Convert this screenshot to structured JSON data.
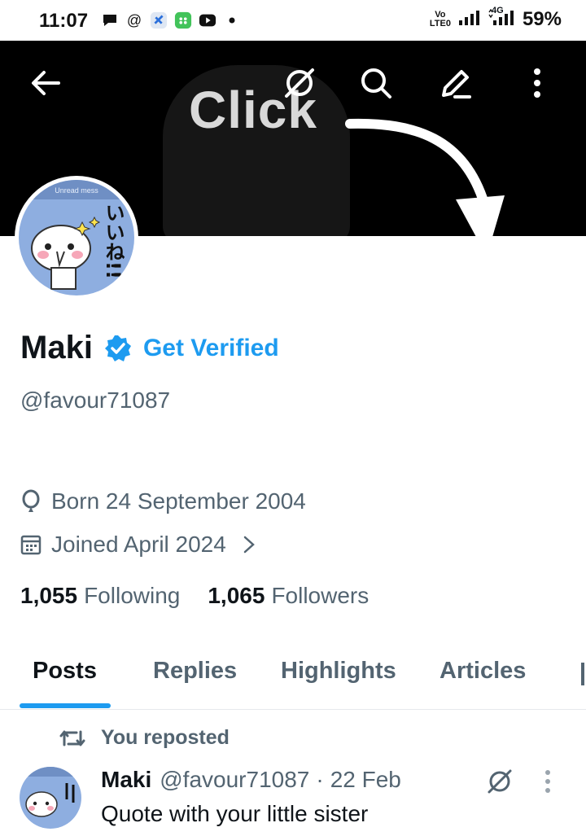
{
  "status_bar": {
    "time": "11:07",
    "volte_top": "Vo",
    "volte_bottom": "LTE0",
    "network": "4G",
    "battery": "59%"
  },
  "banner": {
    "text": "Click"
  },
  "profile": {
    "name": "Maki",
    "get_verified": "Get Verified",
    "handle": "@favour71087",
    "birthday": "Born 24 September 2004",
    "joined": "Joined April 2024",
    "following_count": "1,055",
    "following_label": "Following",
    "followers_count": "1,065",
    "followers_label": "Followers"
  },
  "avatar": {
    "top_text": "Unread mess",
    "side_text": "いいね!!"
  },
  "tabs": [
    "Posts",
    "Replies",
    "Highlights",
    "Articles"
  ],
  "post": {
    "repost_label": "You reposted",
    "name": "Maki",
    "handle": "@favour71087",
    "dot": "·",
    "date": "22 Feb",
    "text": "Quote with your little sister"
  },
  "colors": {
    "accent": "#1d9bf0",
    "text": "#0f1419",
    "muted": "#536471"
  }
}
